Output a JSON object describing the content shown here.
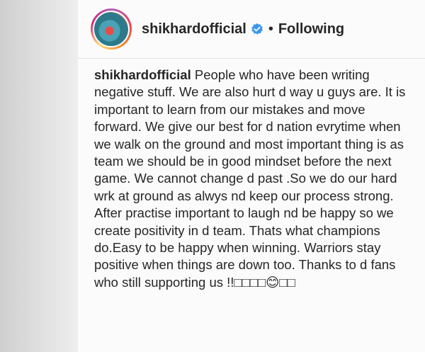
{
  "post": {
    "username": "shikhardofficial",
    "separator": "•",
    "follow_status": "Following",
    "verified_icon": "verified-badge-icon",
    "accent_color": "#3897f0"
  },
  "caption": {
    "username": "shikhardofficial",
    "text": "People who have been writing negative stuff. We are also hurt d way u guys are. It is important to learn from our mistakes and move forward. We give our best for d nation evrytime when we walk on the ground and most important thing is as team we should be in good mindset before the next game. We cannot change d past .So we do our hard wrk at ground as alwys nd keep our process strong. After practise important to laugh nd be happy so we create positivity in d team. Thats what champions do.Easy to be happy when winning. Warriors stay positive when things are down too. Thanks to d fans who still supporting us !!□□□□😊□□"
  }
}
